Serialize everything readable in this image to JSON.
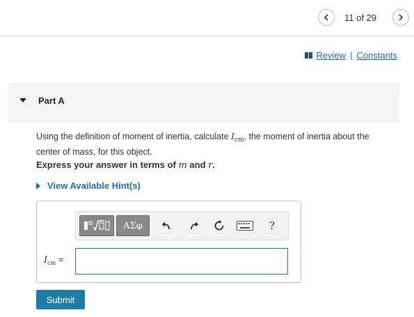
{
  "nav": {
    "counter": "11 of 29",
    "prev_icon": "chevron-left-icon",
    "next_icon": "chevron-right-icon"
  },
  "links": {
    "review": "Review",
    "separator": "|",
    "constants": "Constants",
    "review_icon": "book-icon"
  },
  "part": {
    "title": "Part A"
  },
  "question": {
    "text_before": "Using the definition of moment of inertia, calculate ",
    "symbol": "I",
    "symbol_sub": "cm",
    "text_after": ", the moment of inertia about the center of mass, for this object.",
    "express_prefix": "Express your answer in terms of ",
    "var_m": "m",
    "express_and": " and ",
    "var_r": "r",
    "express_suffix": "."
  },
  "hints": {
    "label": "View Available Hint(s)"
  },
  "toolbar": {
    "templates_icon": "templates-icon",
    "symbols_label": "ΑΣφ",
    "undo_icon": "undo-icon",
    "redo_icon": "redo-icon",
    "reset_icon": "reset-icon",
    "keyboard_icon": "keyboard-icon",
    "help_label": "?"
  },
  "answer": {
    "label_symbol": "I",
    "label_sub": "cm",
    "equals": "=",
    "value": ""
  },
  "submit": {
    "label": "Submit"
  },
  "colors": {
    "link": "#1e6fa8",
    "submit_bg": "#1c7ea4",
    "toolbar_button": "#888888",
    "input_border": "#1e7fa0",
    "part_header_bg": "#f5f5f5"
  }
}
